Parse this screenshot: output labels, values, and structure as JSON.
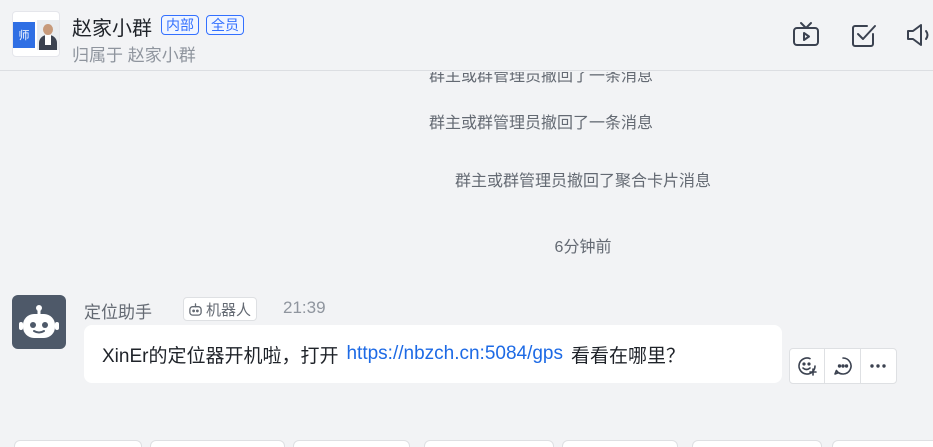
{
  "header": {
    "title": "赵家小群",
    "tags": [
      "内部",
      "全员"
    ],
    "subtitle": "归属于 赵家小群",
    "avatar_tile_text": "师",
    "icons": [
      "tv-icon",
      "task-check-icon",
      "speaker-icon"
    ]
  },
  "system_messages": {
    "partial": "群主或群管理员撤回了一条消息",
    "recall_message": "群主或群管理员撤回了一条消息",
    "recall_card": "群主或群管理员撤回了聚合卡片消息",
    "time_divider": "6分钟前"
  },
  "message": {
    "sender": "定位助手",
    "badge": "机器人",
    "time": "21:39",
    "text_before": "XinEr的定位器开机啦，打开",
    "link": "https://nbzch.cn:5084/gps",
    "text_after": "看看在哪里？"
  },
  "message_actions": [
    "emoji-reaction-icon",
    "reply-icon",
    "more-icon"
  ],
  "colors": {
    "background": "#f2f3f5",
    "accent": "#3370ff",
    "link": "#1d6ae5",
    "bot_avatar": "#4e5969"
  }
}
